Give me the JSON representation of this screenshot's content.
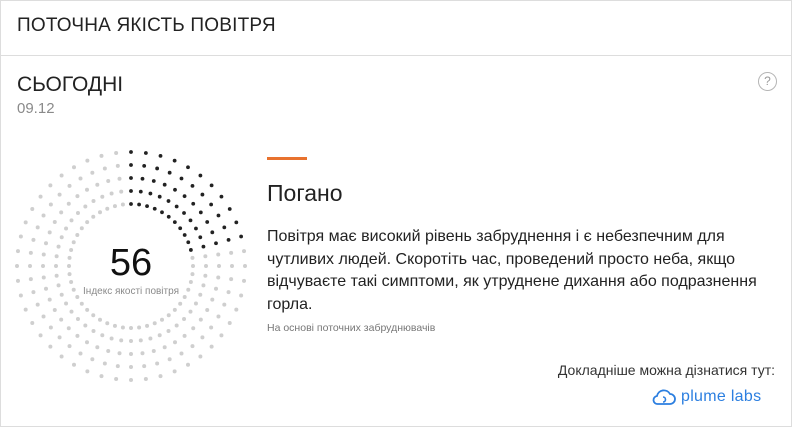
{
  "header": {
    "title": "ПОТОЧНА ЯКІСТЬ ПОВІТРЯ"
  },
  "forecast": {
    "day": "СЬОГОДНІ",
    "date": "09.12"
  },
  "help": {
    "icon": "question-icon",
    "glyph": "?"
  },
  "aqi": {
    "value": "56",
    "label": "Індекс якості повітря",
    "level_fraction": 0.23,
    "active_color": "#222222",
    "inactive_color": "#cfcfcf"
  },
  "status": {
    "label": "Погано",
    "accent_color": "#e8722e",
    "description": "Повітря має високий рівень забруднення і є небезпечним для чутливих людей. Скоротіть час, проведений просто неба, якщо відчуваєте такі симптоми, як утруднене дихання або подразнення горла.",
    "basis": "На основі поточних забруднювачів"
  },
  "footer": {
    "more_label": "Докладніше можна дізнатися тут:",
    "brand_name": "plume labs",
    "brand_icon": "cloud-icon",
    "brand_color": "#2c7fe0"
  }
}
